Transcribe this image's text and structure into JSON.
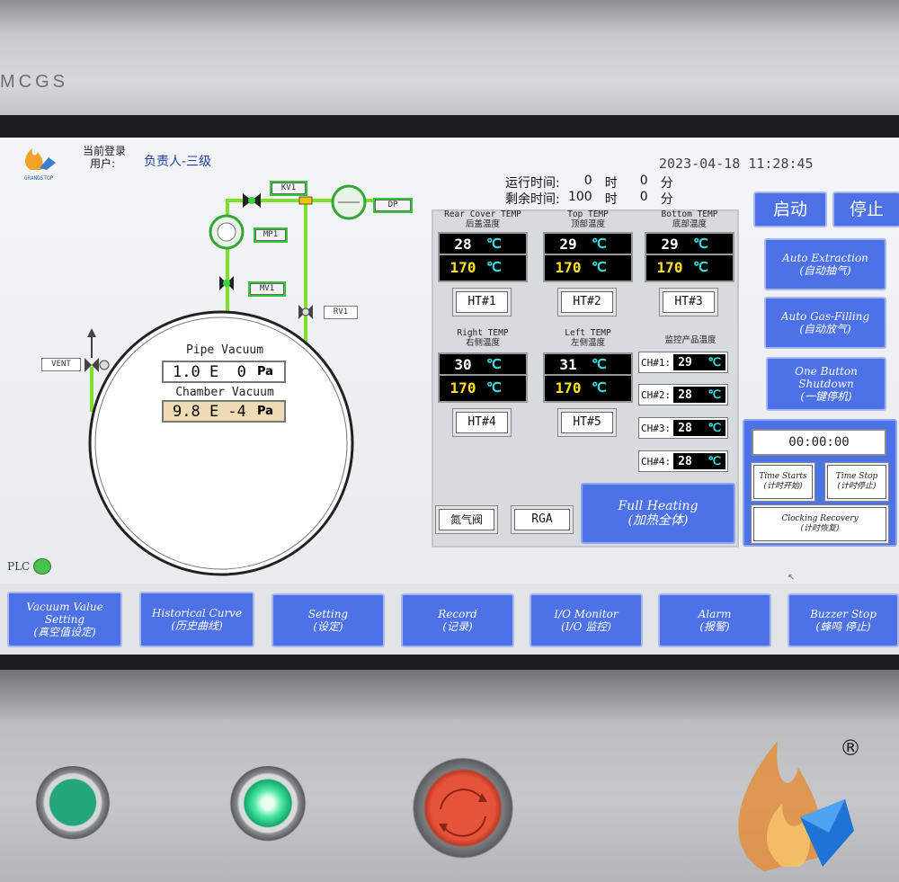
{
  "brand": "MCGS",
  "header": {
    "logo_text": "GRANDSTOP",
    "login_label": "当前登录",
    "user_label": "用户:",
    "user_value": "负责人-三级",
    "datetime": "2023-04-18  11:28:45",
    "run_time": {
      "label": "运行时间:",
      "hours": "0",
      "h_unit": "时",
      "minutes": "0",
      "m_unit": "分"
    },
    "remain_time": {
      "label": "剩余时间:",
      "hours": "100",
      "h_unit": "时",
      "minutes": "0",
      "m_unit": "分"
    }
  },
  "diagram": {
    "valves": {
      "kv1": "KV1",
      "dp": "DP",
      "mp1": "MP1",
      "mv1": "MV1",
      "rv1": "RV1",
      "vent": "VENT"
    },
    "pipe_vacuum_label": "Pipe Vacuum",
    "pipe_vacuum_value": "1.0 E  0",
    "pipe_vacuum_unit": "Pa",
    "chamber_vacuum_label": "Chamber Vacuum",
    "chamber_vacuum_value": "9.8 E -4",
    "chamber_vacuum_unit": "Pa",
    "plc_label": "PLC"
  },
  "zones": [
    {
      "label_en": "Rear Cover TEMP",
      "label_cn": "后盖温度",
      "pv": "28",
      "sv": "170",
      "unit": "℃",
      "btn": "HT#1"
    },
    {
      "label_en": "Top TEMP",
      "label_cn": "顶部温度",
      "pv": "29",
      "sv": "170",
      "unit": "℃",
      "btn": "HT#2"
    },
    {
      "label_en": "Bottom TEMP",
      "label_cn": "底部温度",
      "pv": "29",
      "sv": "170",
      "unit": "℃",
      "btn": "HT#3"
    },
    {
      "label_en": "Right TEMP",
      "label_cn": "右侧温度",
      "pv": "30",
      "sv": "170",
      "unit": "℃",
      "btn": "HT#4"
    },
    {
      "label_en": "Left TEMP",
      "label_cn": "左侧温度",
      "pv": "31",
      "sv": "170",
      "unit": "℃",
      "btn": "HT#5"
    }
  ],
  "monitor": {
    "title": "监控产品温度",
    "channels": [
      {
        "label": "CH#1:",
        "value": "29",
        "unit": "℃"
      },
      {
        "label": "CH#2:",
        "value": "28",
        "unit": "℃"
      },
      {
        "label": "CH#3:",
        "value": "28",
        "unit": "℃"
      },
      {
        "label": "CH#4:",
        "value": "28",
        "unit": "℃"
      }
    ]
  },
  "controls": {
    "nitrogen_valve": "氮气阀",
    "rga": "RGA",
    "full_heating_en": "Full Heating",
    "full_heating_cn": "(加热全体)",
    "start": "启动",
    "stop": "停止",
    "auto_extraction_en": "Auto Extraction",
    "auto_extraction_cn": "(自动抽气)",
    "auto_gas_en": "Auto Gas-Filling",
    "auto_gas_cn": "(自动放气)",
    "shutdown_en1": "One Button",
    "shutdown_en2": "Shutdown",
    "shutdown_cn": "(一键停机)"
  },
  "timer": {
    "display": "00:00:00",
    "start_en": "Time Starts",
    "start_cn": "(计时开始)",
    "stop_en": "Time Stop",
    "stop_cn": "(计时停止)",
    "recovery_en": "Clocking Recovery",
    "recovery_cn": "(计时恢复)"
  },
  "nav": [
    {
      "en": "Vacuum Value Setting",
      "cn": "(真空值设定)"
    },
    {
      "en": "Historical Curve",
      "cn": "(历史曲线)"
    },
    {
      "en": "Setting",
      "cn": "(设定)"
    },
    {
      "en": "Record",
      "cn": "(记录)"
    },
    {
      "en": "I/O Monitor",
      "cn": "(I/O 监控)"
    },
    {
      "en": "Alarm",
      "cn": "(报警)"
    },
    {
      "en": "Buzzer Stop",
      "cn": "(蜂鸣 停止)"
    }
  ],
  "registered_mark": "®",
  "colors": {
    "button_blue": "#4d72e8",
    "pipe_green": "#7fe02a",
    "setpoint_yellow": "#ffe21c",
    "unit_cyan": "#37e0e0"
  }
}
